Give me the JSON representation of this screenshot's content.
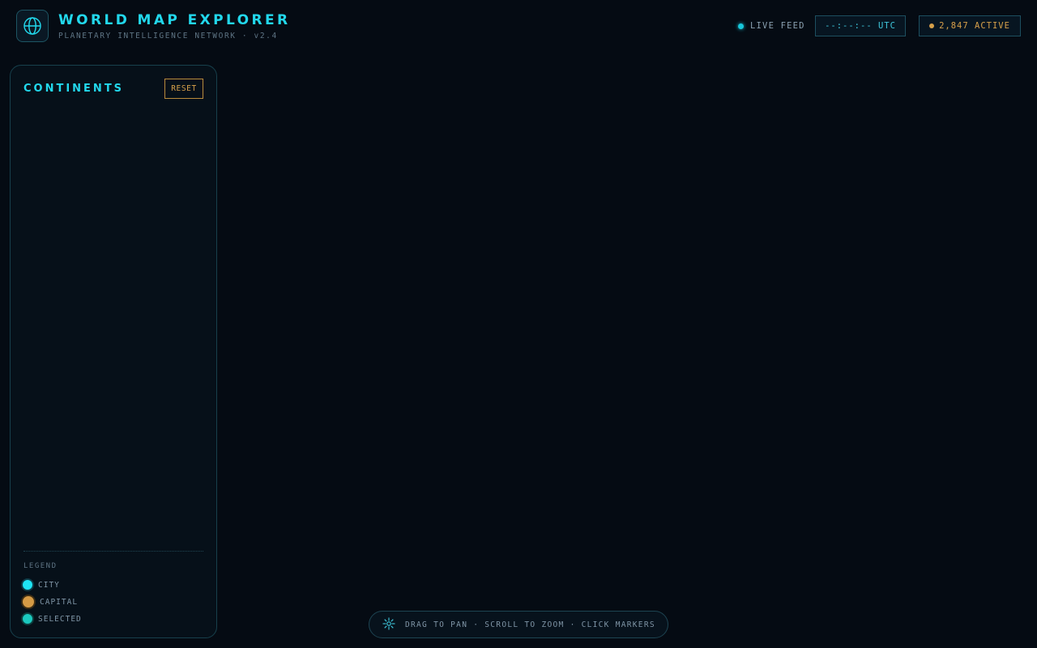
{
  "header": {
    "title": "WORLD MAP EXPLORER",
    "subtitle": "PLANETARY INTELLIGENCE NETWORK · v2.4",
    "live_label": "LIVE FEED",
    "clock": "--:--:-- UTC",
    "active_count": "2,847 ACTIVE"
  },
  "sidebar": {
    "title": "CONTINENTS",
    "reset_label": "RESET",
    "legend_title": "LEGEND",
    "legend": {
      "city": "CITY",
      "capital": "CAPITAL",
      "selected": "SELECTED"
    }
  },
  "hint": {
    "text": "DRAG TO PAN · SCROLL TO ZOOM · CLICK MARKERS"
  },
  "colors": {
    "background": "#050b13",
    "accent": "#22d8ec",
    "amber": "#d6a04a",
    "selected": "#1bc9bf"
  },
  "icons": {
    "logo": "globe-icon",
    "hint": "move-crosshair-icon"
  }
}
